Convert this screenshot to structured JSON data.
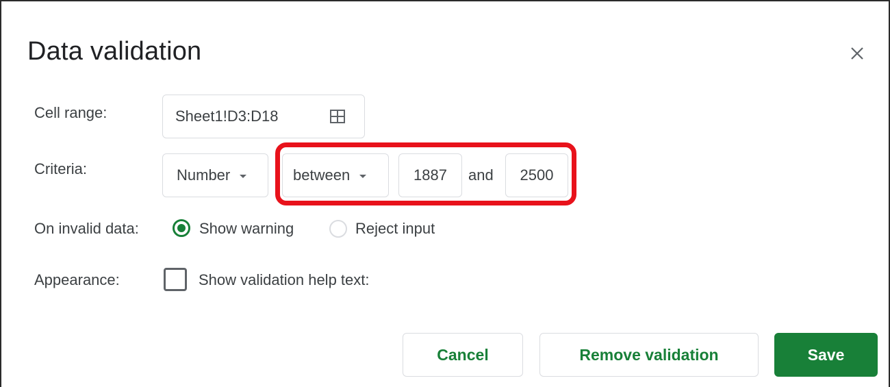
{
  "dialog": {
    "title": "Data validation"
  },
  "cell_range": {
    "label": "Cell range:",
    "value": "Sheet1!D3:D18",
    "icon": "grid-icon"
  },
  "criteria": {
    "label": "Criteria:",
    "type_value": "Number",
    "operator_value": "between",
    "min_value": "1887",
    "connector": "and",
    "max_value": "2500"
  },
  "invalid_data": {
    "label": "On invalid data:",
    "options": [
      {
        "label": "Show warning",
        "selected": true
      },
      {
        "label": "Reject input",
        "selected": false
      }
    ]
  },
  "appearance": {
    "label": "Appearance:",
    "checkbox_label": "Show validation help text:",
    "checked": false
  },
  "buttons": {
    "cancel": "Cancel",
    "remove": "Remove validation",
    "save": "Save"
  },
  "colors": {
    "accent_green": "#188038",
    "highlight_red": "#e8121b"
  }
}
